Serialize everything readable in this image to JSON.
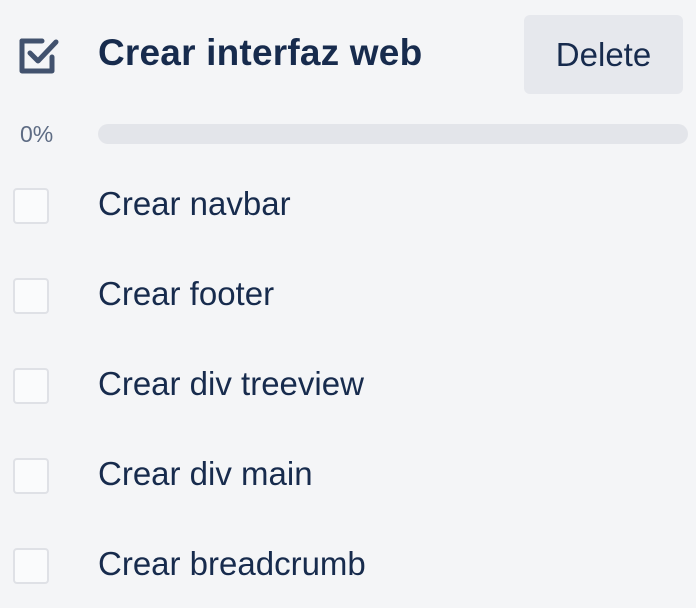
{
  "checklist": {
    "icon": "checked-checkbox-icon",
    "title": "Crear interfaz web",
    "delete_label": "Delete",
    "progress": {
      "label": "0%",
      "value": 0
    },
    "items": [
      {
        "label": "Crear navbar",
        "checked": false
      },
      {
        "label": "Crear footer",
        "checked": false
      },
      {
        "label": "Crear div treeview",
        "checked": false
      },
      {
        "label": "Crear div main",
        "checked": false
      },
      {
        "label": "Crear breadcrumb",
        "checked": false
      }
    ]
  },
  "colors": {
    "background": "#f4f5f7",
    "text": "#172b4d",
    "muted": "#5e6c84",
    "button_bg": "#e6e8ed",
    "progress_track": "#e3e5ea",
    "checkbox_border": "#dfe1e6"
  }
}
